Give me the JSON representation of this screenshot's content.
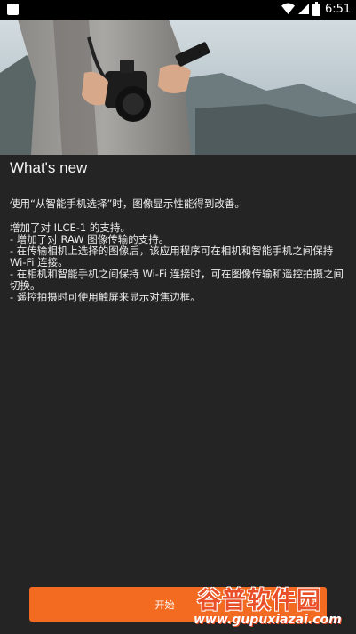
{
  "status_bar": {
    "time": "6:51",
    "icons": [
      "app-notification-icon",
      "wifi-icon",
      "signal-icon",
      "battery-icon"
    ]
  },
  "hero": {
    "description_icon": "camera-and-phone-photo"
  },
  "whats_new": {
    "title": "What's new",
    "intro": "使用“从智能手机选择”时，图像显示性能得到改善。",
    "notes": [
      "增加了对 ILCE-1 的支持。",
      "- 增加了对 RAW 图像传输的支持。",
      "- 在传输相机上选择的图像后，该应用程序可在相机和智能手机之间保持",
      "Wi-Fi 连接。",
      "- 在相机和智能手机之间保持 Wi-Fi 连接时，可在图像传输和遥控拍摄之间",
      "切换。",
      "- 遥控拍摄时可使用触屏来显示对焦边框。"
    ]
  },
  "start_button": {
    "label": "开始"
  },
  "watermark": {
    "top": "谷普软件园",
    "bottom": "www.gupuxiazai.com"
  },
  "colors": {
    "background": "#242424",
    "accent": "#f26b21",
    "status_bar": "#000000"
  }
}
